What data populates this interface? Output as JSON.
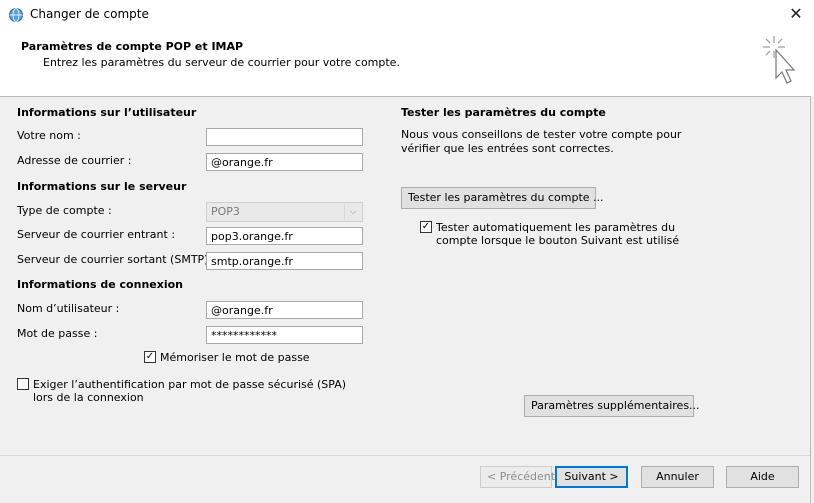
{
  "window": {
    "title": "Changer de compte",
    "close_glyph": "✕"
  },
  "header": {
    "title": "Paramètres de compte POP et IMAP",
    "subtitle": "Entrez les paramètres du serveur de courrier pour votre compte."
  },
  "user_info": {
    "section_title": "Informations sur l’utilisateur",
    "name_label": "Votre nom :",
    "name_value": "",
    "email_label": "Adresse de courrier :",
    "email_value": "@orange.fr"
  },
  "server_info": {
    "section_title": "Informations sur le serveur",
    "account_type_label": "Type de compte :",
    "account_type_value": "POP3",
    "incoming_label": "Serveur de courrier entrant :",
    "incoming_value": "pop3.orange.fr",
    "outgoing_label": "Serveur de courrier sortant (SMTP) :",
    "outgoing_value": "smtp.orange.fr"
  },
  "logon_info": {
    "section_title": "Informations de connexion",
    "username_label": "Nom d’utilisateur :",
    "username_value": "@orange.fr",
    "password_label": "Mot de passe :",
    "password_value": "************",
    "remember_label": "Mémoriser le mot de passe",
    "remember_checked": true,
    "spa_label_line1": "Exiger l’authentification par mot de passe sécurisé (SPA)",
    "spa_label_line2": "lors de la connexion",
    "spa_checked": false
  },
  "test_settings": {
    "section_title": "Tester les paramètres du compte",
    "description_line1": "Nous vous conseillons de tester votre compte pour",
    "description_line2": "vérifier que les entrées sont correctes.",
    "test_button": "Tester les paramètres du compte ...",
    "auto_test_line1": "Tester automatiquement les paramètres du",
    "auto_test_line2": "compte lorsque le bouton Suivant est utilisé",
    "auto_test_checked": true
  },
  "more_settings_button": "Paramètres supplémentaires...",
  "footer": {
    "back": "< Précédent",
    "next": "Suivant >",
    "cancel": "Annuler",
    "help": "Aide"
  }
}
